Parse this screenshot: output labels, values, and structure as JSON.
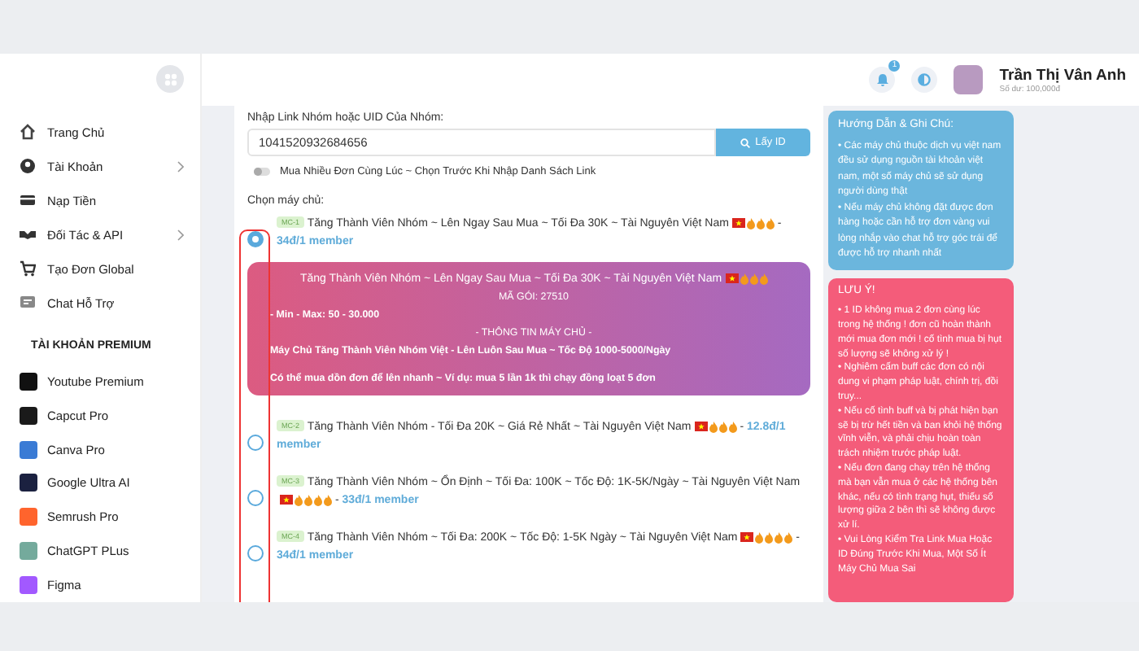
{
  "sidebar": {
    "menu": [
      {
        "label": "Trang Chủ",
        "has_submenu": false
      },
      {
        "label": "Tài Khoản",
        "has_submenu": true
      },
      {
        "label": "Nạp Tiền",
        "has_submenu": false
      },
      {
        "label": "Đối Tác & API",
        "has_submenu": true
      },
      {
        "label": "Tạo Đơn Global",
        "has_submenu": false
      },
      {
        "label": "Chat Hỗ Trợ",
        "has_submenu": false
      }
    ],
    "section_title": "TÀI KHOẢN PREMIUM",
    "premium": [
      {
        "label": "Youtube Premium",
        "color": "#111111"
      },
      {
        "label": "Capcut Pro",
        "color": "#1a1a1a"
      },
      {
        "label": "Canva Pro",
        "color": "#3a7bd5"
      },
      {
        "label": "Google Ultra AI",
        "color": "#1b2140"
      },
      {
        "label": "Semrush Pro",
        "color": "#ff642d"
      },
      {
        "label": "ChatGPT PLus",
        "color": "#74aa9c"
      },
      {
        "label": "Figma",
        "color": "#a259ff"
      }
    ]
  },
  "header": {
    "notifications": "1",
    "user": {
      "name": "Trần Thị Vân Anh",
      "balance": "Số dư: 100,000đ"
    }
  },
  "form": {
    "link_label": "Nhập Link Nhóm hoặc UID Của Nhóm:",
    "link_value": "1041520932684656",
    "fetch_button": "Lấy ID",
    "bulk_toggle": {
      "label": "Mua Nhiều Đơn Cùng Lúc ~ Chọn Trước Khi Nhập Danh Sách Link",
      "on": false
    },
    "server_label": "Chọn máy chủ:"
  },
  "servers": [
    {
      "tag": "MC-1",
      "title": "Tăng Thành Viên Nhóm ~ Lên Ngay Sau Mua ~ Tối Đa 30K ~ Tài Nguyên Việt Nam",
      "badges": [
        {
          "kind": "flag"
        },
        {
          "kind": "fire"
        },
        {
          "kind": "fire"
        },
        {
          "kind": "fire"
        }
      ],
      "separator": "-",
      "price": "34đ/1 member",
      "selected": true
    },
    {
      "tag": "MC-2",
      "title": "Tăng Thành Viên Nhóm - Tối Đa 20K ~ Giá Rẻ Nhất ~ Tài Nguyên Việt Nam",
      "badges": [
        {
          "kind": "flag"
        },
        {
          "kind": "fire"
        },
        {
          "kind": "fire"
        },
        {
          "kind": "fire"
        }
      ],
      "separator": "-",
      "price": "12.8đ/1 member",
      "selected": false
    },
    {
      "tag": "MC-3",
      "title": "Tăng Thành Viên Nhóm ~ Ổn Định ~ Tối Đa: 100K ~ Tốc Độ: 1K-5K/Ngày ~ Tài Nguyên Việt Nam",
      "badges": [
        {
          "kind": "flag"
        },
        {
          "kind": "fire"
        },
        {
          "kind": "fire"
        },
        {
          "kind": "fire"
        },
        {
          "kind": "fire"
        }
      ],
      "separator": "-",
      "price": "33đ/1 member",
      "selected": false
    },
    {
      "tag": "MC-4",
      "title": "Tăng Thành Viên Nhóm ~ Tối Đa: 200K ~ Tốc Độ: 1-5K Ngày ~ Tài Nguyên Việt Nam",
      "badges": [
        {
          "kind": "flag"
        },
        {
          "kind": "fire"
        },
        {
          "kind": "fire"
        },
        {
          "kind": "fire"
        },
        {
          "kind": "fire"
        }
      ],
      "separator": "-",
      "price": "34đ/1 member",
      "selected": false
    }
  ],
  "server_detail": {
    "title": "Tăng Thành Viên Nhóm ~ Lên Ngay Sau Mua ~ Tối Đa 30K ~ Tài Nguyên Việt Nam",
    "badges": [
      {
        "kind": "flag"
      },
      {
        "kind": "fire"
      },
      {
        "kind": "fire"
      },
      {
        "kind": "fire"
      }
    ],
    "package_code": "MÃ GÓI: 27510",
    "limits": "- Min - Max: 50 - 30.000",
    "info_heading": "- THÔNG TIN MÁY CHỦ -",
    "description": "Máy Chủ Tăng Thành Viên Nhóm Việt - Lên Luôn Sau Mua ~ Tốc Độ 1000-5000/Ngày",
    "note": "Có thể mua dồn đơn để lên nhanh ~ Ví dụ: mua 5 lần 1k thì chạy đồng loạt 5 đơn"
  },
  "guide": {
    "title": "Hướng Dẫn & Ghi Chú:",
    "lines": [
      "• Các máy chủ thuộc dịch vụ việt nam đều sử dụng nguồn tài khoản việt nam, một số máy chủ sẽ sử dụng người dùng thật",
      "• Nếu máy chủ không đặt được đơn hàng hoặc cần hỗ trợ đơn vàng vui lòng nhắp vào chat hỗ trợ góc trái để được hỗ trợ nhanh nhất"
    ]
  },
  "notice": {
    "title": "LƯU Ý!",
    "lines": [
      "• 1 ID không mua 2 đơn cùng lúc trong hệ thống ! đơn cũ hoàn thành mới mua đơn mới ! cố tình mua bị hụt số lượng sẽ không xử lý !",
      "• Nghiêm cấm buff các đơn có nội dung vi phạm pháp luật, chính trị, đồi truy...",
      "• Nếu cố tình buff và bị phát hiện bạn sẽ bị trừ hết tiền và ban khỏi hệ thống vĩnh viễn, và phải chịu hoàn toàn trách nhiệm trước pháp luật.",
      "• Nếu đơn đang chạy trên hệ thống mà bạn vẫn mua ở các hệ thống bên khác, nếu có tình trạng hụt, thiếu số lượng giữa 2 bên thì sẽ không được xử lí.",
      "• Vui Lòng Kiểm Tra Link Mua Hoặc ID Đúng Trước Khi Mua, Một Số Ít Máy Chủ Mua Sai"
    ]
  }
}
